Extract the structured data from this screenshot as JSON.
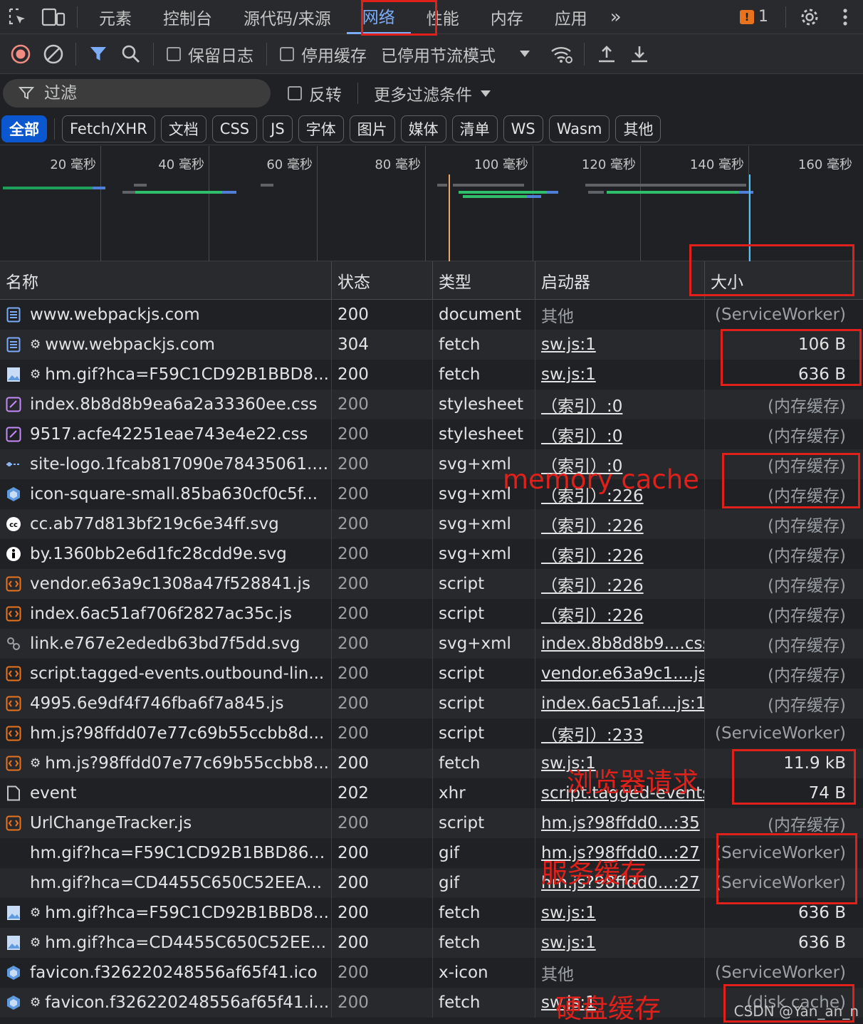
{
  "tabs": [
    "元素",
    "控制台",
    "源代码/来源",
    "网络",
    "性能",
    "内存",
    "应用"
  ],
  "active_tab": "网络",
  "tab_more": "»",
  "issues_count": "1",
  "issue_flag": "!",
  "toolbar": {
    "preserve_log": "保留日志",
    "disable_cache": "停用缓存",
    "throttling": "已停用节流模式"
  },
  "filter": {
    "placeholder": "过滤",
    "invert": "反转",
    "more_filters": "更多过滤条件"
  },
  "type_chips": [
    "全部",
    "Fetch/XHR",
    "文档",
    "CSS",
    "JS",
    "字体",
    "图片",
    "媒体",
    "清单",
    "WS",
    "Wasm",
    "其他"
  ],
  "timeline_labels": [
    "20 毫秒",
    "40 毫秒",
    "60 毫秒",
    "80 毫秒",
    "100 毫秒",
    "120 毫秒",
    "140 毫秒",
    "160 毫秒"
  ],
  "columns": {
    "name": "名称",
    "status": "状态",
    "type": "类型",
    "initiator": "启动器",
    "size": "大小"
  },
  "rows": [
    {
      "icon": "document",
      "gear": false,
      "name": "www.webpackjs.com",
      "status": "200",
      "type": "document",
      "initiator": "其他",
      "initiator_link": false,
      "size": "(ServiceWorker)",
      "status_dim": false,
      "size_dim": true
    },
    {
      "icon": "document",
      "gear": true,
      "name": "www.webpackjs.com",
      "status": "304",
      "type": "fetch",
      "initiator": "sw.js:1",
      "initiator_link": true,
      "size": "106 B",
      "status_dim": false,
      "size_dim": false
    },
    {
      "icon": "image",
      "gear": true,
      "name": "hm.gif?hca=F59C1CD92B1BBD8...",
      "status": "200",
      "type": "fetch",
      "initiator": "sw.js:1",
      "initiator_link": true,
      "size": "636 B",
      "status_dim": false,
      "size_dim": false
    },
    {
      "icon": "css",
      "gear": false,
      "name": "index.8b8d8b9ea6a2a33360ee.css",
      "status": "200",
      "type": "stylesheet",
      "initiator": "（索引）:0",
      "initiator_link": true,
      "size": "(内存缓存)",
      "status_dim": true,
      "size_dim": true
    },
    {
      "icon": "css",
      "gear": false,
      "name": "9517.acfe42251eae743e4e22.css",
      "status": "200",
      "type": "stylesheet",
      "initiator": "（索引）:0",
      "initiator_link": true,
      "size": "(内存缓存)",
      "status_dim": true,
      "size_dim": true
    },
    {
      "icon": "logo",
      "gear": false,
      "name": "site-logo.1fcab817090e78435061.s...",
      "status": "200",
      "type": "svg+xml",
      "initiator": "（索引）:0",
      "initiator_link": true,
      "size": "(内存缓存)",
      "status_dim": true,
      "size_dim": true
    },
    {
      "icon": "cube",
      "gear": false,
      "name": "icon-square-small.85ba630cf0c5f...",
      "status": "200",
      "type": "svg+xml",
      "initiator": "（索引）:226",
      "initiator_link": true,
      "size": "(内存缓存)",
      "status_dim": true,
      "size_dim": true
    },
    {
      "icon": "cc",
      "gear": false,
      "name": "cc.ab77d813bf219c6e34ff.svg",
      "status": "200",
      "type": "svg+xml",
      "initiator": "（索引）:226",
      "initiator_link": true,
      "size": "(内存缓存)",
      "status_dim": true,
      "size_dim": true
    },
    {
      "icon": "by",
      "gear": false,
      "name": "by.1360bb2e6d1fc28cdd9e.svg",
      "status": "200",
      "type": "svg+xml",
      "initiator": "（索引）:226",
      "initiator_link": true,
      "size": "(内存缓存)",
      "status_dim": true,
      "size_dim": true
    },
    {
      "icon": "script",
      "gear": false,
      "name": "vendor.e63a9c1308a47f528841.js",
      "status": "200",
      "type": "script",
      "initiator": "（索引）:226",
      "initiator_link": true,
      "size": "(内存缓存)",
      "status_dim": true,
      "size_dim": true
    },
    {
      "icon": "script",
      "gear": false,
      "name": "index.6ac51af706f2827ac35c.js",
      "status": "200",
      "type": "script",
      "initiator": "（索引）:226",
      "initiator_link": true,
      "size": "(内存缓存)",
      "status_dim": true,
      "size_dim": true
    },
    {
      "icon": "link",
      "gear": false,
      "name": "link.e767e2ededb63bd7f5dd.svg",
      "status": "200",
      "type": "svg+xml",
      "initiator": "index.8b8d8b9....css",
      "initiator_link": true,
      "size": "(内存缓存)",
      "status_dim": true,
      "size_dim": true
    },
    {
      "icon": "script",
      "gear": false,
      "name": "script.tagged-events.outbound-lin...",
      "status": "200",
      "type": "script",
      "initiator": "vendor.e63a9c1....js",
      "initiator_link": true,
      "size": "(内存缓存)",
      "status_dim": true,
      "size_dim": true
    },
    {
      "icon": "script",
      "gear": false,
      "name": "4995.6e9df4f746fba6f7a845.js",
      "status": "200",
      "type": "script",
      "initiator": "index.6ac51af....js:1",
      "initiator_link": true,
      "size": "(内存缓存)",
      "status_dim": true,
      "size_dim": true
    },
    {
      "icon": "script",
      "gear": false,
      "name": "hm.js?98ffdd07e77c69b55ccbb8d...",
      "status": "200",
      "type": "script",
      "initiator": "（索引）:233",
      "initiator_link": true,
      "size": "(ServiceWorker)",
      "status_dim": true,
      "size_dim": true
    },
    {
      "icon": "script",
      "gear": true,
      "name": "hm.js?98ffdd07e77c69b55ccbb8...",
      "status": "200",
      "type": "fetch",
      "initiator": "sw.js:1",
      "initiator_link": true,
      "size": "11.9 kB",
      "status_dim": false,
      "size_dim": false
    },
    {
      "icon": "blank",
      "gear": false,
      "name": "event",
      "status": "202",
      "type": "xhr",
      "initiator": "script.tagged-events",
      "initiator_link": true,
      "size": "74 B",
      "status_dim": false,
      "size_dim": false
    },
    {
      "icon": "script",
      "gear": false,
      "name": "UrlChangeTracker.js",
      "status": "200",
      "type": "script",
      "initiator": "hm.js?98ffdd0...:35",
      "initiator_link": true,
      "size": "(内存缓存)",
      "status_dim": true,
      "size_dim": true
    },
    {
      "icon": "none",
      "gear": false,
      "name": "hm.gif?hca=F59C1CD92B1BBD86&...",
      "status": "200",
      "type": "gif",
      "initiator": "hm.js?98ffdd0...:27",
      "initiator_link": true,
      "size": "(ServiceWorker)",
      "status_dim": false,
      "size_dim": true
    },
    {
      "icon": "none",
      "gear": false,
      "name": "hm.gif?hca=CD4455C650C52EEA...",
      "status": "200",
      "type": "gif",
      "initiator": "hm.js?98ffdd0...:27",
      "initiator_link": true,
      "size": "(ServiceWorker)",
      "status_dim": false,
      "size_dim": true
    },
    {
      "icon": "image",
      "gear": true,
      "name": "hm.gif?hca=F59C1CD92B1BBD8...",
      "status": "200",
      "type": "fetch",
      "initiator": "sw.js:1",
      "initiator_link": true,
      "size": "636 B",
      "status_dim": false,
      "size_dim": false
    },
    {
      "icon": "image",
      "gear": true,
      "name": "hm.gif?hca=CD4455C650C52EE...",
      "status": "200",
      "type": "fetch",
      "initiator": "sw.js:1",
      "initiator_link": true,
      "size": "636 B",
      "status_dim": false,
      "size_dim": false
    },
    {
      "icon": "cube",
      "gear": false,
      "name": "favicon.f326220248556af65f41.ico",
      "status": "200",
      "type": "x-icon",
      "initiator": "其他",
      "initiator_link": false,
      "size": "(ServiceWorker)",
      "status_dim": true,
      "size_dim": true
    },
    {
      "icon": "cube",
      "gear": true,
      "name": "favicon.f326220248556af65f41.i...",
      "status": "200",
      "type": "fetch",
      "initiator": "sw.js:1",
      "initiator_link": true,
      "size": "(disk cache)",
      "status_dim": true,
      "size_dim": true
    }
  ],
  "annotations": {
    "memory_cache": "memory cache",
    "browser_request": "浏览器请求",
    "service_cache": "服务缓存",
    "disk_cache": "硬盘缓存"
  },
  "watermark": "CSDN @Yan_an_n",
  "colors": {
    "accent": "#7cacf8",
    "annotation_red": "#e0201b",
    "active_chip": "#0b57d0",
    "record_red": "#f28b82"
  }
}
